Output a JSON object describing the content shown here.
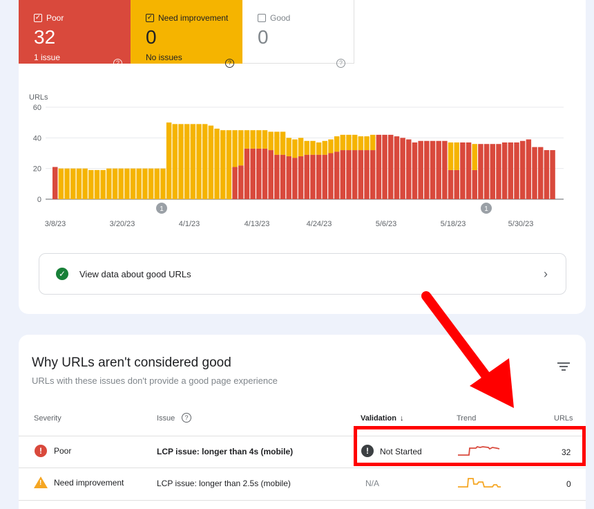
{
  "tiles": {
    "poor": {
      "label": "Poor",
      "count": "32",
      "sub": "1 issue",
      "checked": true,
      "color": "#d9493c"
    },
    "need": {
      "label": "Need improvement",
      "count": "0",
      "sub": "No issues",
      "checked": true,
      "color": "#f5b400"
    },
    "good": {
      "label": "Good",
      "count": "0",
      "checked": false
    }
  },
  "chart_data": {
    "type": "bar",
    "stacked": true,
    "ylabel": "URLs",
    "ylim": [
      0,
      60
    ],
    "yticks": [
      "60",
      "40",
      "20",
      "0"
    ],
    "x_tick_labels": [
      "3/8/23",
      "3/20/23",
      "4/1/23",
      "4/13/23",
      "4/24/23",
      "5/6/23",
      "5/18/23",
      "5/30/23"
    ],
    "annotations": [
      "1",
      "1"
    ],
    "series": [
      {
        "name": "Poor",
        "color": "#d9493c",
        "values": [
          21,
          0,
          0,
          0,
          0,
          0,
          0,
          0,
          0,
          0,
          0,
          0,
          0,
          0,
          0,
          0,
          0,
          0,
          0,
          0,
          0,
          0,
          0,
          0,
          0,
          0,
          0,
          0,
          0,
          0,
          21,
          22,
          33,
          33,
          33,
          33,
          32,
          29,
          29,
          28,
          27,
          28,
          29,
          29,
          29,
          29,
          30,
          31,
          32,
          32,
          32,
          32,
          32,
          32,
          42,
          42,
          42,
          41,
          40,
          39,
          37,
          38,
          38,
          38,
          38,
          38,
          19,
          19,
          37,
          37,
          19,
          36,
          36,
          36,
          36,
          37,
          37,
          37,
          38,
          39,
          34,
          34,
          32,
          32
        ]
      },
      {
        "name": "Need improvement",
        "color": "#f5b400",
        "values": [
          0,
          20,
          20,
          20,
          20,
          20,
          19,
          19,
          19,
          20,
          20,
          20,
          20,
          20,
          20,
          20,
          20,
          20,
          20,
          50,
          49,
          49,
          49,
          49,
          49,
          49,
          48,
          46,
          45,
          45,
          24,
          23,
          12,
          12,
          12,
          12,
          12,
          15,
          15,
          12,
          12,
          12,
          9,
          9,
          8,
          9,
          9,
          10,
          10,
          10,
          10,
          9,
          9,
          10,
          0,
          0,
          0,
          0,
          0,
          0,
          0,
          0,
          0,
          0,
          0,
          0,
          18,
          18,
          0,
          0,
          17,
          0,
          0,
          0,
          0,
          0,
          0,
          0,
          0,
          0,
          0,
          0,
          0,
          0
        ]
      }
    ]
  },
  "good_link": {
    "label": "View data about good URLs"
  },
  "issues": {
    "title": "Why URLs aren't considered good",
    "subtitle": "URLs with these issues don't provide a good page experience",
    "headers": {
      "severity": "Severity",
      "issue": "Issue",
      "validation": "Validation",
      "trend": "Trend",
      "urls": "URLs"
    },
    "rows": [
      {
        "severity": "Poor",
        "issue": "LCP issue: longer than 4s (mobile)",
        "validation": "Not Started",
        "urls": "32",
        "trend_color": "#d9493c"
      },
      {
        "severity": "Need improvement",
        "issue": "LCP issue: longer than 2.5s (mobile)",
        "validation": "N/A",
        "urls": "0",
        "trend_color": "#f5a623"
      }
    ]
  },
  "colors": {
    "highlight": "#ff0000"
  }
}
